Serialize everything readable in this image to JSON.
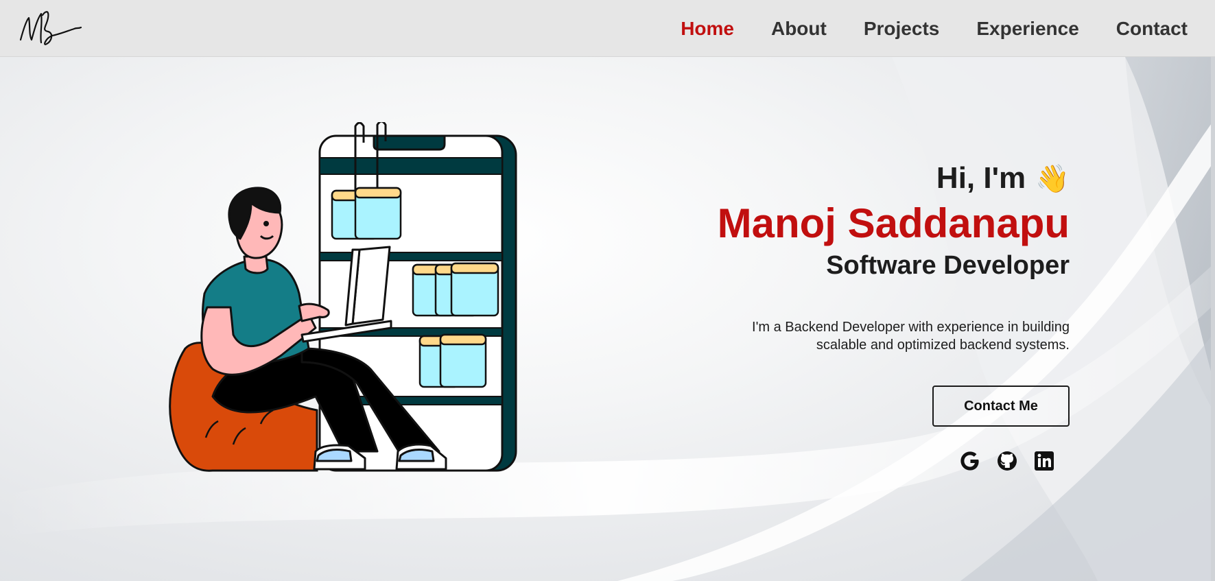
{
  "nav": {
    "logo_alt": "MS",
    "links": [
      {
        "label": "Home",
        "active": true
      },
      {
        "label": "About"
      },
      {
        "label": "Projects"
      },
      {
        "label": "Experience"
      },
      {
        "label": "Contact"
      }
    ]
  },
  "hero": {
    "greeting": "Hi, I'm",
    "wave_emoji": "👋",
    "name": "Manoj Saddanapu",
    "role": "Software Developer",
    "description": "I'm a Backend Developer with experience in building scalable and optimized backend systems.",
    "cta_label": "Contact Me",
    "socials": [
      {
        "icon": "google-icon"
      },
      {
        "icon": "github-icon"
      },
      {
        "icon": "linkedin-icon"
      }
    ]
  },
  "colors": {
    "accent": "#c10f0f",
    "text": "#1d1d1d",
    "nav_bg": "#e6e6e6",
    "shelf": "#003a40",
    "shirt": "#147d87",
    "beanbag": "#d94a0a",
    "box_fill": "#aaf3ff",
    "box_lid": "#ffd98a"
  }
}
